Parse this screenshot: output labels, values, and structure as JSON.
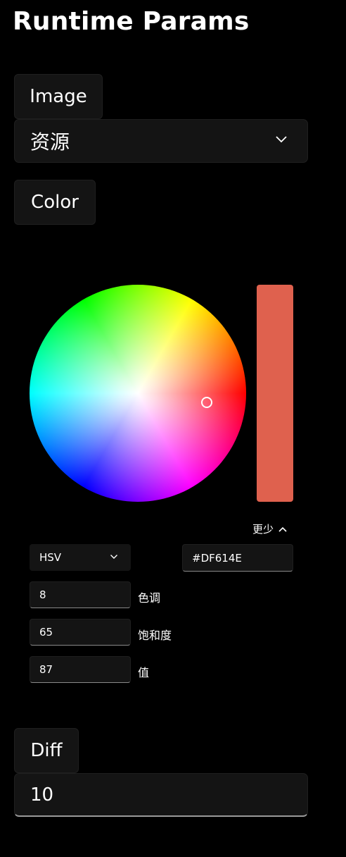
{
  "header": {
    "title": "Runtime Params"
  },
  "image_section": {
    "label": "Image",
    "dropdown_value": "资源"
  },
  "color_section": {
    "label": "Color",
    "selected_color": "#DF614E",
    "toggle_label": "更少",
    "mode_value": "HSV",
    "hex_value": "#DF614E",
    "hue": {
      "value": "8",
      "label": "色调"
    },
    "saturation": {
      "value": "65",
      "label": "饱和度"
    },
    "brightness": {
      "value": "87",
      "label": "值"
    }
  },
  "diff_section": {
    "label": "Diff",
    "value": "10"
  }
}
